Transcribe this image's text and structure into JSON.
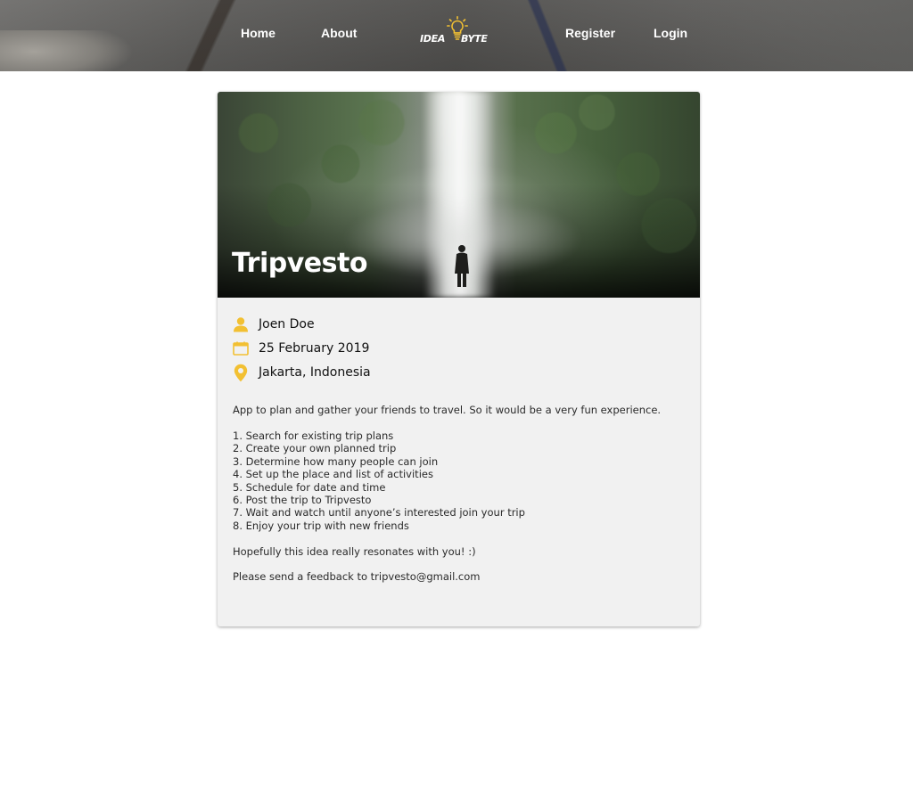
{
  "nav": {
    "home": "Home",
    "about": "About",
    "register": "Register",
    "login": "Login",
    "logo_left": "IDEA",
    "logo_right": "BYTE"
  },
  "post": {
    "title": "Tripvesto",
    "author": "Joen Doe",
    "date": "25 February 2019",
    "location": "Jakarta, Indonesia",
    "intro": "App to plan and gather your friends to travel. So it would be a very fun experience.",
    "steps": [
      "1. Search for existing trip plans",
      "2. Create your own planned trip",
      "3. Determine how many people can join",
      "4. Set up the place and list of activities",
      "5. Schedule for date and time",
      "6. Post the trip to Tripvesto",
      "7. Wait and watch until anyone’s interested join your trip",
      "8. Enjoy your trip with new friends"
    ],
    "closing": "Hopefully this idea really resonates with you! :)",
    "feedback": "Please send a feedback to tripvesto@gmail.com"
  },
  "icons": {
    "author": "user-icon",
    "date": "calendar-icon",
    "location": "map-pin-icon",
    "logo": "lightbulb-icon"
  },
  "colors": {
    "accent": "#f2c032",
    "card_bg": "#f1f1f1",
    "nav_text": "#ffffff"
  }
}
